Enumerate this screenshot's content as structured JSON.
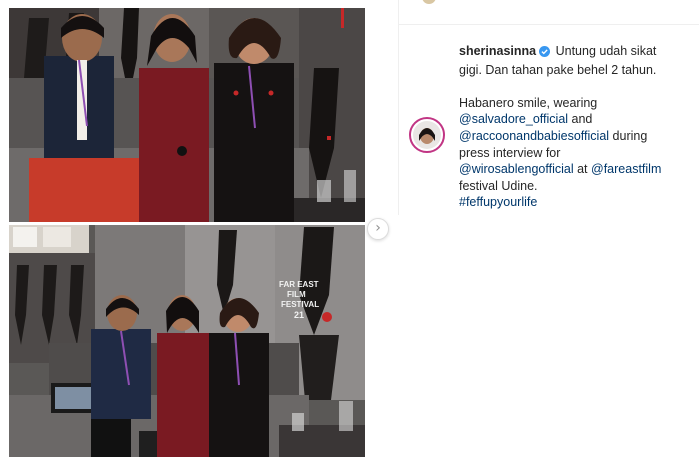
{
  "post": {
    "username": "sherinasinna",
    "caption_intro": "Untung udah sikat gigi. Dan tahan pake behel 2 tahun.",
    "caption_line1": "Habanero smile, wearing",
    "mention_salvadore": "@salvadore_official",
    "text_and": "and",
    "mention_raccoon": "@raccoonandbabiesofficial",
    "text_during": "during",
    "text_press": "press interview for",
    "mention_wiro": "@wirosablengofficial",
    "text_at": "at",
    "mention_fareast": "@fareastfilm",
    "text_festival": "festival Udine.",
    "hashtag": "#feffupyourlife"
  },
  "poster_text": {
    "far_east": "FAR EAST",
    "film": "FILM",
    "festival": "FESTIVAL",
    "number": "21"
  },
  "icons": {
    "next": "chevron-right-icon",
    "verified": "verified-badge-icon"
  },
  "colors": {
    "link": "#00376b",
    "verified": "#3897f0",
    "avatar_ring": "#c13584"
  }
}
